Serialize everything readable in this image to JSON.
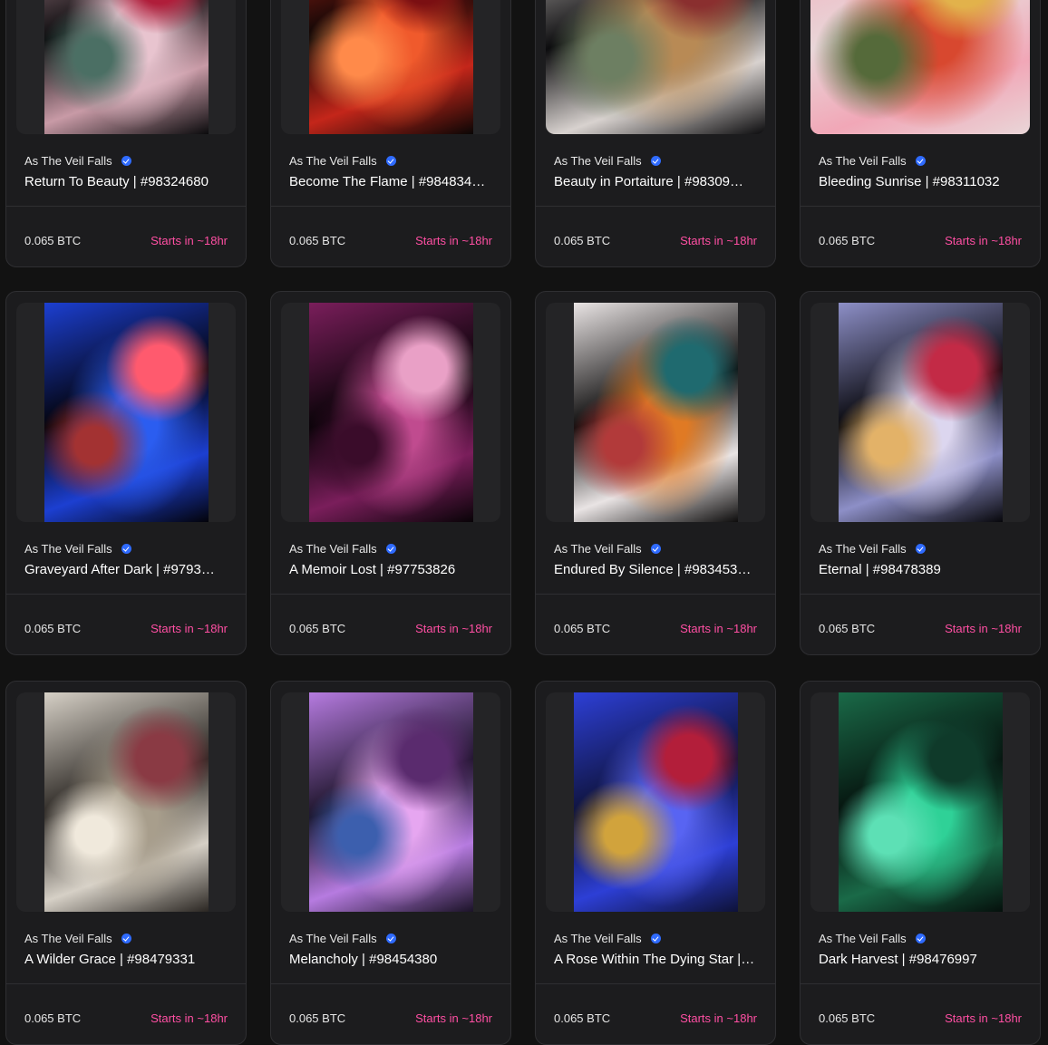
{
  "cards": [
    {
      "collection": "As The Veil Falls",
      "title": "Return To Beauty | #98324680",
      "price": "0.065 BTC",
      "status": "Starts in ~18hr",
      "palette": [
        "#0b0b0d",
        "#c89aa6",
        "#e8c4cf",
        "#b01d3a",
        "#4b6f64"
      ]
    },
    {
      "collection": "As The Veil Falls",
      "title": "Become The Flame | #984834…",
      "price": "0.065 BTC",
      "status": "Starts in ~18hr",
      "palette": [
        "#0a0605",
        "#c4261a",
        "#f05a2c",
        "#7b0f12",
        "#ff8a4a"
      ]
    },
    {
      "collection": "As The Veil Falls",
      "title": "Beauty in Portaiture | #98309…",
      "price": "0.065 BTC",
      "status": "Starts in ~18hr",
      "palette": [
        "#0c0c0e",
        "#d8d2cf",
        "#b88a55",
        "#8a2f2f",
        "#6d7f62"
      ]
    },
    {
      "collection": "As The Veil Falls",
      "title": "Bleeding Sunrise | #98311032",
      "price": "0.065 BTC",
      "status": "Starts in ~18hr",
      "palette": [
        "#e9d6d8",
        "#f1a7b7",
        "#d8482f",
        "#e2b24b",
        "#556a3a"
      ]
    },
    {
      "collection": "As The Veil Falls",
      "title": "Graveyard After Dark | #9793…",
      "price": "0.065 BTC",
      "status": "Starts in ~18hr",
      "palette": [
        "#03030a",
        "#1c3fd1",
        "#2b5df0",
        "#ff5a6e",
        "#a33232"
      ]
    },
    {
      "collection": "As The Veil Falls",
      "title": "A Memoir Lost | #97753826",
      "price": "0.065 BTC",
      "status": "Starts in ~18hr",
      "palette": [
        "#080307",
        "#7a1e5b",
        "#c04b8f",
        "#e9a0c6",
        "#3a0c2a"
      ]
    },
    {
      "collection": "As The Veil Falls",
      "title": "Endured By Silence | #983453…",
      "price": "0.065 BTC",
      "status": "Starts in ~18hr",
      "palette": [
        "#0d0c0c",
        "#e9e4e4",
        "#e07a24",
        "#1f6a6f",
        "#b23a3a"
      ]
    },
    {
      "collection": "As The Veil Falls",
      "title": "Eternal | #98478389",
      "price": "0.065 BTC",
      "status": "Starts in ~18hr",
      "palette": [
        "#07070b",
        "#8d8fc7",
        "#dcd6ef",
        "#c32a46",
        "#e3b268"
      ]
    },
    {
      "collection": "As The Veil Falls",
      "title": "A Wilder Grace | #98479331",
      "price": "0.065 BTC",
      "status": "Starts in ~18hr",
      "palette": [
        "#2a2622",
        "#d6d0c6",
        "#a89e8c",
        "#8a3a44",
        "#f0e9dc"
      ]
    },
    {
      "collection": "As The Veil Falls",
      "title": "Melancholy | #98454380",
      "price": "0.065 BTC",
      "status": "Starts in ~18hr",
      "palette": [
        "#1b1328",
        "#b67be0",
        "#e6a6f0",
        "#5a2b6e",
        "#3c5fae"
      ]
    },
    {
      "collection": "As The Veil Falls",
      "title": "A Rose Within The Dying Star |…",
      "price": "0.065 BTC",
      "status": "Starts in ~18hr",
      "palette": [
        "#0e1238",
        "#2d3fd6",
        "#5864f2",
        "#b31e3a",
        "#d1a33c"
      ]
    },
    {
      "collection": "As The Veil Falls",
      "title": "Dark Harvest | #98476997",
      "price": "0.065 BTC",
      "status": "Starts in ~18hr",
      "palette": [
        "#05100c",
        "#1a6a48",
        "#2fd197",
        "#0f3a2a",
        "#5de0b5"
      ]
    }
  ]
}
